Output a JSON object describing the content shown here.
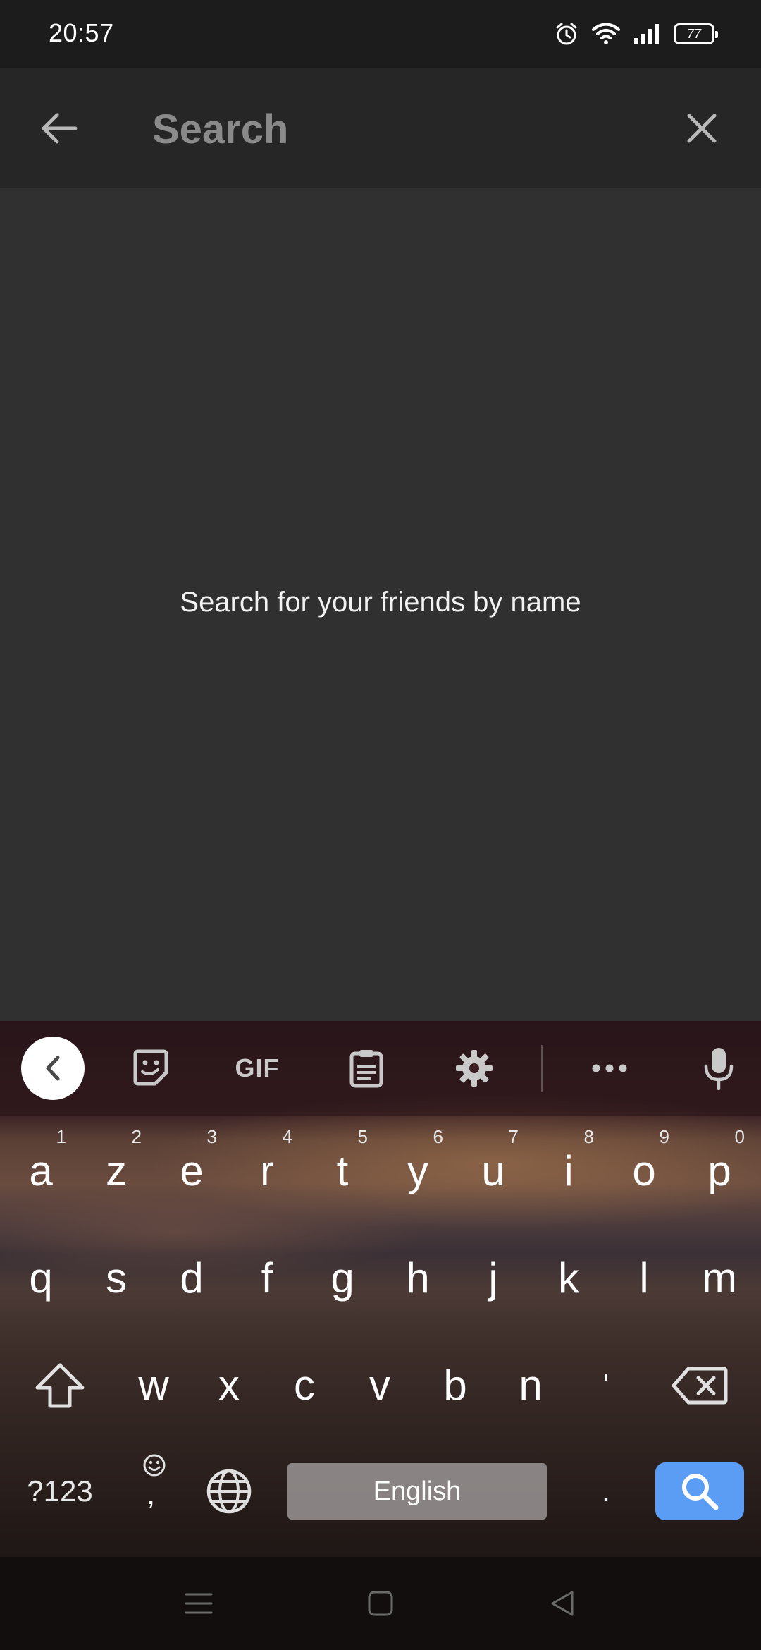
{
  "status_bar": {
    "time": "20:57",
    "battery": "77",
    "icons": [
      "alarm-icon",
      "wifi-icon",
      "signal-icon",
      "battery-icon"
    ]
  },
  "app_bar": {
    "search_placeholder": "Search",
    "search_value": "",
    "back_icon": "arrow-left-icon",
    "clear_icon": "close-icon"
  },
  "main": {
    "hint": "Search for your friends by name"
  },
  "keyboard": {
    "toolbar": {
      "items": [
        "chevron-left-icon",
        "sticker-icon",
        "GIF",
        "clipboard-icon",
        "gear-icon",
        "more-icon",
        "mic-icon"
      ],
      "gif_label": "GIF"
    },
    "row1": [
      {
        "key": "a",
        "hint": "1"
      },
      {
        "key": "z",
        "hint": "2"
      },
      {
        "key": "e",
        "hint": "3"
      },
      {
        "key": "r",
        "hint": "4"
      },
      {
        "key": "t",
        "hint": "5"
      },
      {
        "key": "y",
        "hint": "6"
      },
      {
        "key": "u",
        "hint": "7"
      },
      {
        "key": "i",
        "hint": "8"
      },
      {
        "key": "o",
        "hint": "9"
      },
      {
        "key": "p",
        "hint": "0"
      }
    ],
    "row2": [
      "q",
      "s",
      "d",
      "f",
      "g",
      "h",
      "j",
      "k",
      "l",
      "m"
    ],
    "row3": [
      "w",
      "x",
      "c",
      "v",
      "b",
      "n",
      "'"
    ],
    "row4": {
      "symbols": "?123",
      "comma": ",",
      "space": "English",
      "period": "."
    },
    "accent_color": "#5b9cf5"
  },
  "nav_bar": {
    "icons": [
      "menu-icon",
      "home-icon",
      "back-icon"
    ]
  }
}
